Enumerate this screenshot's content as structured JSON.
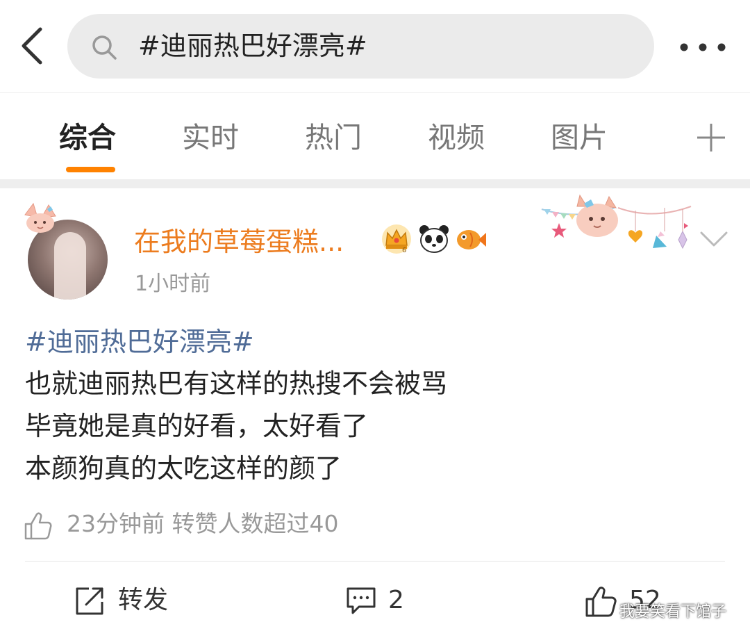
{
  "header": {
    "back_icon": "chevron-left-icon",
    "search_icon": "search-icon",
    "search_query": "#迪丽热巴好漂亮#",
    "more_icon": "more-dots-icon"
  },
  "tabs": {
    "items": [
      {
        "label": "综合",
        "active": true
      },
      {
        "label": "实时",
        "active": false
      },
      {
        "label": "热门",
        "active": false
      },
      {
        "label": "视频",
        "active": false
      },
      {
        "label": "图片",
        "active": false
      }
    ],
    "add_icon": "plus-icon",
    "accent_color": "#ff8200"
  },
  "post": {
    "username": "在我的草莓蛋糕...",
    "username_color": "#ec7c1f",
    "badges": [
      "crown-badge-icon",
      "panda-badge-icon",
      "fish-badge-icon"
    ],
    "time": "1小时前",
    "hashtag": "#迪丽热巴好漂亮#",
    "hashtag_color": "#506c97",
    "lines": [
      "也就迪丽热巴有这样的热搜不会被骂",
      "毕竟她是真的好看，太好看了",
      "本颜狗真的太吃这样的颜了"
    ],
    "like_info": "23分钟前 转赞人数超过40",
    "actions": {
      "repost_label": "转发",
      "comment_count": "2",
      "like_count": "52"
    }
  },
  "watermark": "我要笑看下馆子"
}
